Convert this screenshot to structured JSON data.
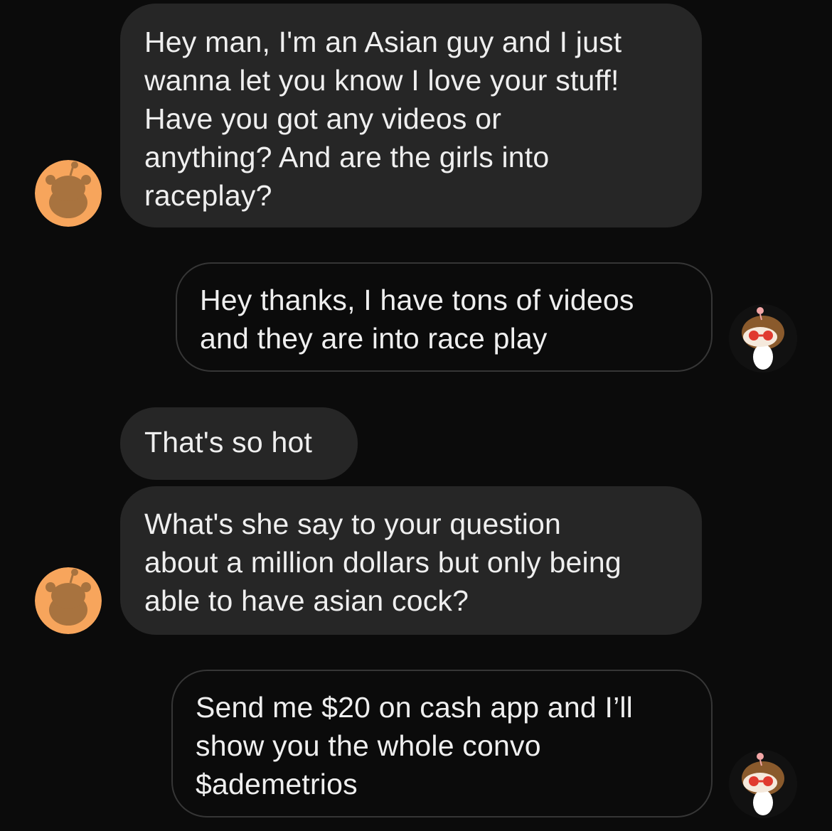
{
  "messages": [
    {
      "sender": "other",
      "text": "Hey man, I'm an Asian guy and I just\nwanna let you know I love your stuff!\nHave you got any videos or\nanything? And are the girls into\nraceplay?"
    },
    {
      "sender": "self",
      "text": "Hey thanks, I have tons of videos\nand they are into race play"
    },
    {
      "sender": "other",
      "text": "That's so hot"
    },
    {
      "sender": "other",
      "text": "What's she say to your question\nabout a million dollars but only being\nable to have asian cock?"
    },
    {
      "sender": "self",
      "text": "Send me $20 on cash app and I’ll\nshow you the whole convo\n$ademetrios"
    }
  ],
  "colors": {
    "background": "#0b0b0b",
    "incoming_bubble": "#262626",
    "outgoing_border": "#363636",
    "text": "#efefef",
    "snoo_avatar_bg": "#f7a55c",
    "snoo_silhouette": "#a8733f"
  },
  "icons": {
    "other_avatar": "reddit-snoo-avatar-icon",
    "self_avatar": "custom-snoo-avatar-icon"
  }
}
